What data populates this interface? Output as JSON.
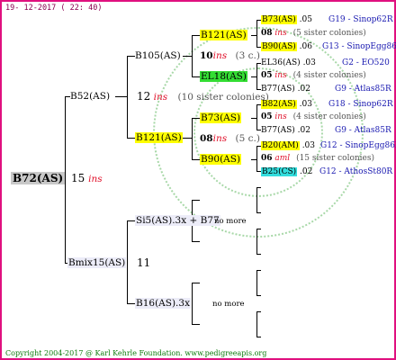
{
  "header": {
    "date": "19- 12-2017 ( 22: 40)"
  },
  "footer": {
    "text": "Copyright 2004-2017 @ Karl Kehrle Foundation.   www.pedigreeapis.org"
  },
  "root": {
    "name": "B72(AS)",
    "num": "15",
    "ins": "ins"
  },
  "gen1": {
    "upper": {
      "name": "B52(AS)"
    },
    "lower": {
      "name": "Bmix15(AS)",
      "num": "11"
    }
  },
  "gen2": {
    "b105": {
      "name": "B105(AS)",
      "num": "12",
      "ins": "ins",
      "note": "(10 sister colonies)"
    },
    "b121": {
      "name": "B121(AS)"
    },
    "si5": {
      "name": "Si5(AS).3x + B77",
      "nomore": "no more"
    },
    "b16": {
      "name": "B16(AS).3x",
      "nomore": "no more"
    }
  },
  "gen3": {
    "b121a": {
      "name": "B121(AS)",
      "num": "10",
      "ins": "ins",
      "note": "(3 c.)"
    },
    "el18": {
      "name": "EL18(AS)"
    },
    "b73": {
      "name": "B73(AS)"
    },
    "num08": "08",
    "ins08": "ins",
    "note08": "(5 c.)",
    "b90": {
      "name": "B90(AS)"
    }
  },
  "gen4": [
    {
      "name": "B73(AS)",
      "val": ".05",
      "info": "G19 - Sinop62R"
    },
    {
      "num": "08",
      "ins": "ins",
      "note": "(5 sister colonies)"
    },
    {
      "name": "B90(AS)",
      "val": ".06",
      "info": "G13 - SinopEgg86R"
    },
    {
      "name": "EL36(AS)",
      "val": ".03",
      "info": "G2 - EO520"
    },
    {
      "num": "05",
      "ins": "ins",
      "note": "(4 sister colonies)"
    },
    {
      "name": "B77(AS)",
      "val": ".02",
      "info": "G9 - Atlas85R"
    },
    {
      "name": "B82(AS)",
      "val": ".03",
      "info": "G18 - Sinop62R"
    },
    {
      "num": "05",
      "ins": "ins",
      "note": "(4 sister colonies)"
    },
    {
      "name": "B77(AS)",
      "val": ".02",
      "info": "G9 - Atlas85R"
    },
    {
      "name": "B20(AM)",
      "val": ".03",
      "info": "G12 - SinopEgg86R"
    },
    {
      "num": "06",
      "ins": "aml",
      "note": "(15 sister colonies)"
    },
    {
      "name": "B25(CS)",
      "val": ".02",
      "info": "G12 - AthosSt80R"
    }
  ]
}
